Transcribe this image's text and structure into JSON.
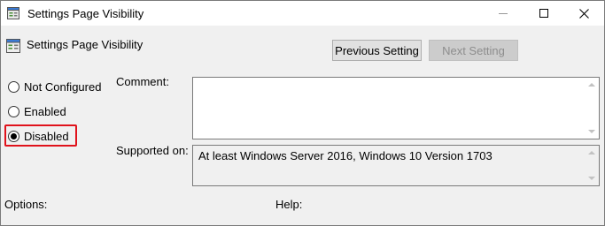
{
  "window": {
    "title": "Settings Page Visibility",
    "icon": "policy-settings-icon",
    "controls": {
      "minimize": "minimize-icon",
      "maximize": "maximize-icon",
      "close": "close-icon"
    }
  },
  "header": {
    "setting_name": "Settings Page Visibility",
    "previous_button": "Previous Setting",
    "next_button": "Next Setting"
  },
  "state": {
    "options": [
      {
        "label": "Not Configured",
        "checked": false
      },
      {
        "label": "Enabled",
        "checked": false
      },
      {
        "label": "Disabled",
        "checked": true
      }
    ],
    "highlight_color": "#e0121b"
  },
  "comment": {
    "label": "Comment:",
    "value": ""
  },
  "supported": {
    "label": "Supported on:",
    "value": "At least Windows Server 2016, Windows 10 Version 1703"
  },
  "footer": {
    "options_label": "Options:",
    "help_label": "Help:"
  }
}
